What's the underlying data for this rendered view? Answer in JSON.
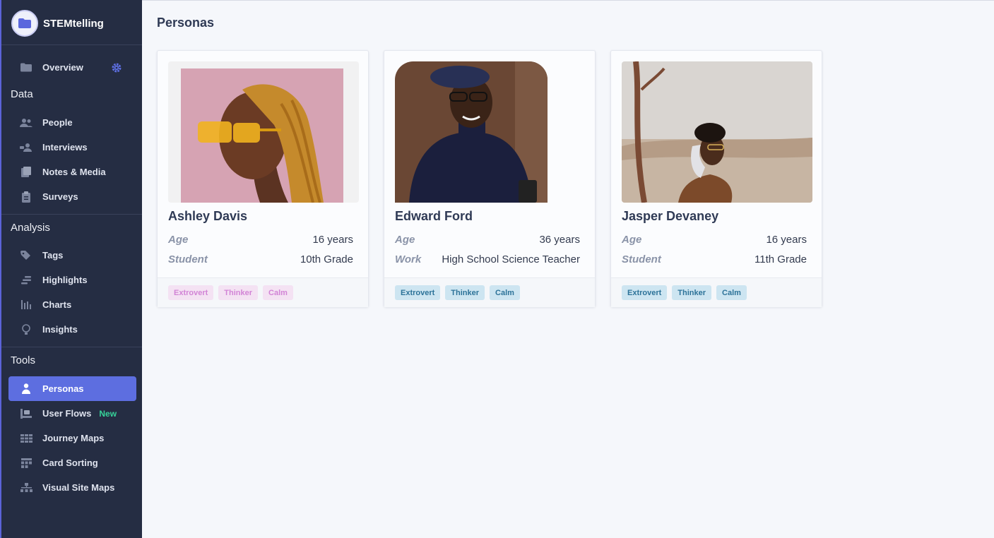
{
  "app": {
    "name": "STEMtelling"
  },
  "sidebar": {
    "overview": "Overview",
    "sections": {
      "data": "Data",
      "analysis": "Analysis",
      "tools": "Tools"
    },
    "data_items": [
      "People",
      "Interviews",
      "Notes & Media",
      "Surveys"
    ],
    "analysis_items": [
      "Tags",
      "Highlights",
      "Charts",
      "Insights"
    ],
    "tools_items": [
      "Personas",
      "User Flows",
      "Journey Maps",
      "Card Sorting",
      "Visual Site Maps"
    ],
    "new_badge": "New",
    "active": "Personas",
    "accent_color": "#5d6ee0"
  },
  "page": {
    "title": "Personas"
  },
  "personas": [
    {
      "name": "Ashley Davis",
      "fields": [
        {
          "label": "Age",
          "value": "16 years"
        },
        {
          "label": "Student",
          "value": "10th Grade"
        }
      ],
      "tags": [
        "Extrovert",
        "Thinker",
        "Calm"
      ],
      "tag_color": "#f4e2f3"
    },
    {
      "name": "Edward Ford",
      "fields": [
        {
          "label": "Age",
          "value": "36 years"
        },
        {
          "label": "Work",
          "value": "High School Science Teacher"
        }
      ],
      "tags": [
        "Extrovert",
        "Thinker",
        "Calm"
      ],
      "tag_color": "#cde5f1"
    },
    {
      "name": "Jasper Devaney",
      "fields": [
        {
          "label": "Age",
          "value": "16 years"
        },
        {
          "label": "Student",
          "value": "11th Grade"
        }
      ],
      "tags": [
        "Extrovert",
        "Thinker",
        "Calm"
      ],
      "tag_color": "#cde5f1"
    }
  ]
}
